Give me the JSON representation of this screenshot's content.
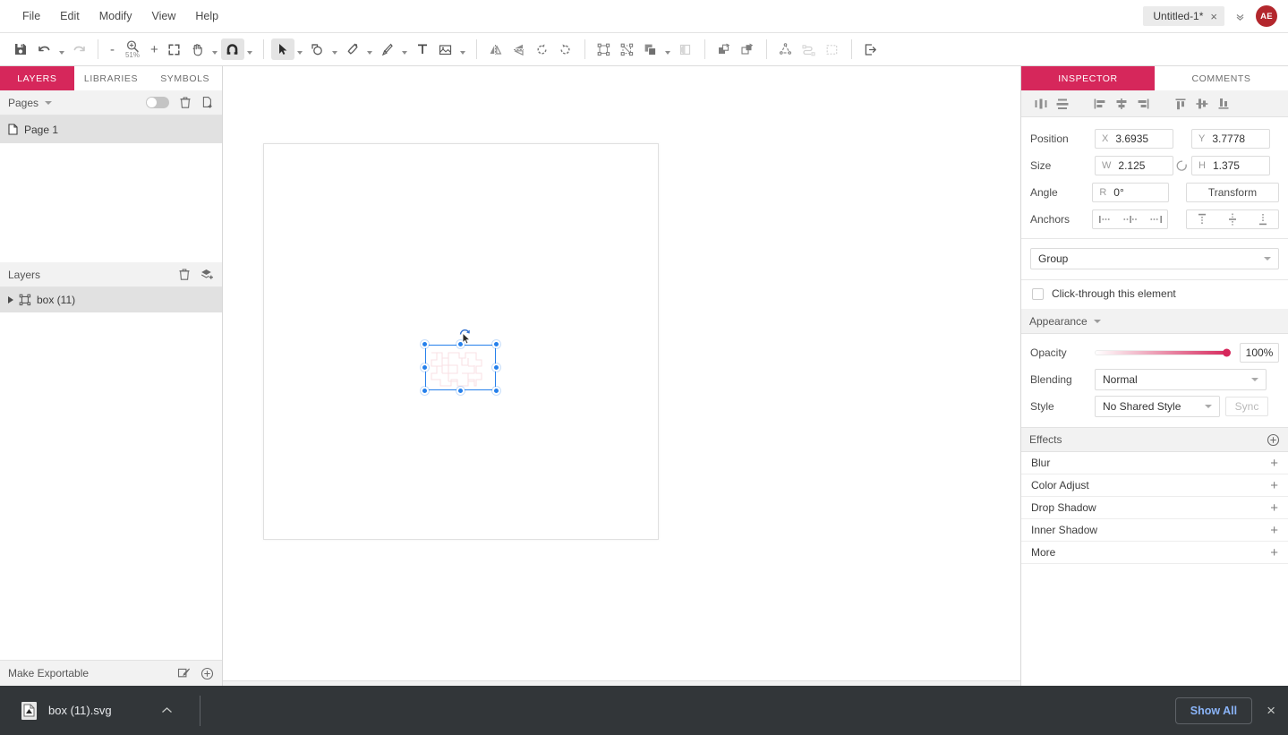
{
  "app": {
    "menu": [
      "File",
      "Edit",
      "Modify",
      "View",
      "Help"
    ],
    "document_tab": {
      "title": "Untitled-1*",
      "close": "×"
    },
    "tabs_overflow": "⌄",
    "avatar_initials": "AE",
    "accent_color": "#d6275b",
    "avatar_color": "#b3272d"
  },
  "toolbar": {
    "zoom_out": "-",
    "zoom_level": "51%",
    "zoom_in": "+",
    "icons": {
      "save": "save-icon",
      "undo": "undo-icon",
      "redo": "redo-icon",
      "zoom": "zoom-icon",
      "fit": "fit-screen-icon",
      "hand": "hand-icon",
      "magnet": "magnet-snap-icon",
      "select": "select-arrow-icon",
      "shape": "shape-icon",
      "pen": "pen-icon",
      "brush": "brush-icon",
      "text": "text-icon",
      "image": "image-icon",
      "flip_h": "flip-horizontal-icon",
      "flip_v": "flip-vertical-icon",
      "rotate_ccw": "rotate-ccw-icon",
      "rotate_cw": "rotate-cw-icon",
      "group": "group-icon",
      "ungroup": "ungroup-icon",
      "boolean": "boolean-ops-icon",
      "mask": "mask-icon",
      "bring_forward": "bring-forward-icon",
      "send_backward": "send-backward-icon",
      "convert_path": "convert-to-path-icon",
      "outline_stroke": "outline-stroke-icon",
      "marquee": "marquee-icon",
      "export": "export-icon"
    },
    "text_tool_label": "T"
  },
  "left_panel": {
    "tabs": [
      {
        "label": "LAYERS",
        "active": true
      },
      {
        "label": "LIBRARIES",
        "active": false
      },
      {
        "label": "SYMBOLS",
        "active": false
      }
    ],
    "pages": {
      "title": "Pages",
      "items": [
        {
          "label": "Page 1",
          "selected": true
        }
      ],
      "actions": {
        "toggle": "visibility-toggle",
        "delete": "trash-icon",
        "add": "add-page-icon"
      }
    },
    "layers": {
      "title": "Layers",
      "items": [
        {
          "label": "box (11)",
          "selected": true,
          "expandable": true
        }
      ],
      "actions": {
        "delete": "trash-icon",
        "add": "add-layer-icon"
      }
    },
    "footer": {
      "label": "Make Exportable",
      "actions": {
        "slice": "slice-icon",
        "add": "plus-circle-icon"
      }
    }
  },
  "canvas": {
    "selection": {
      "handles": 8,
      "rotate_cursor": "rotate-cursor-icon"
    }
  },
  "right_panel": {
    "tabs": [
      {
        "label": "INSPECTOR",
        "active": true
      },
      {
        "label": "COMMENTS",
        "active": false
      }
    ],
    "align": {
      "distribute_h": "distribute-horizontal-icon",
      "distribute_v": "distribute-vertical-icon",
      "align_left": "align-left-icon",
      "align_center": "align-center-icon",
      "align_right": "align-right-icon",
      "align_top": "align-top-icon",
      "align_middle": "align-middle-icon",
      "align_bottom": "align-bottom-icon"
    },
    "properties": {
      "position": {
        "label": "Position",
        "x_key": "X",
        "x_value": "3.6935",
        "y_key": "Y",
        "y_value": "3.7778"
      },
      "size": {
        "label": "Size",
        "w_key": "W",
        "w_value": "2.125",
        "h_key": "H",
        "h_value": "1.375",
        "link": "link-ratio-icon"
      },
      "angle": {
        "label": "Angle",
        "r_key": "R",
        "r_value": "0°",
        "transform_label": "Transform"
      },
      "anchors": {
        "label": "Anchors"
      }
    },
    "object_type": "Group",
    "click_through": {
      "label": "Click-through this element",
      "checked": false
    },
    "appearance": {
      "title": "Appearance",
      "opacity": {
        "label": "Opacity",
        "value": "100%"
      },
      "blending": {
        "label": "Blending",
        "value": "Normal"
      },
      "style": {
        "label": "Style",
        "value": "No Shared Style",
        "sync_label": "Sync"
      }
    },
    "effects": {
      "title": "Effects",
      "add_icon": "plus-circle-icon",
      "items": [
        {
          "label": "Blur",
          "add": "+"
        },
        {
          "label": "Color Adjust",
          "add": "+"
        },
        {
          "label": "Drop Shadow",
          "add": "+"
        },
        {
          "label": "Inner Shadow",
          "add": "+"
        },
        {
          "label": "More",
          "add": "+"
        }
      ]
    }
  },
  "download_bar": {
    "file_name": "box (11).svg",
    "file_icon": "svg-file-icon",
    "expand": "⌃",
    "show_all_label": "Show All",
    "close": "×"
  }
}
